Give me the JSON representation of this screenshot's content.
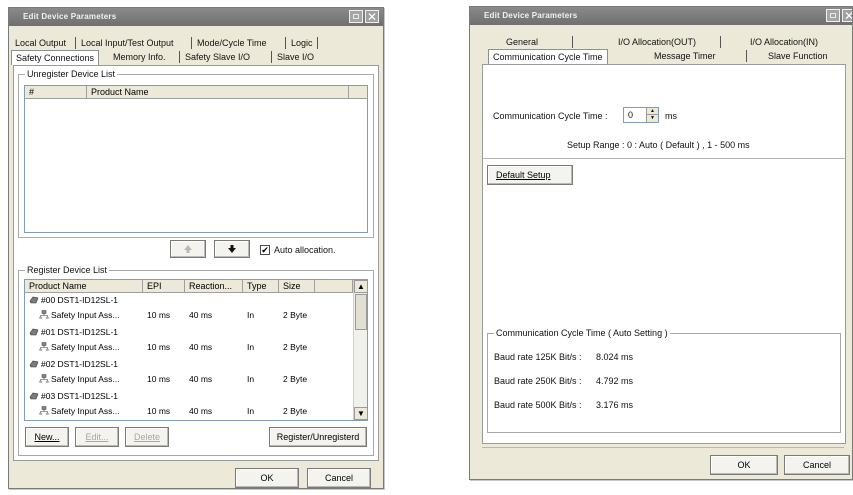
{
  "left_window": {
    "title": "Edit Device Parameters",
    "tabs_row1": [
      "Local Output",
      "Local Input/Test Output",
      "Mode/Cycle Time",
      "Logic"
    ],
    "tabs_row2": [
      "Safety Connections",
      "Memory Info.",
      "Safety Slave I/O",
      "Slave I/O"
    ],
    "unregister": {
      "title": "Unregister Device List",
      "col_num": "#",
      "col_product": "Product Name"
    },
    "auto_allocation": {
      "label": "Auto allocation.",
      "checked": true,
      "mark": "✔"
    },
    "register": {
      "title": "Register Device List",
      "columns": [
        "Product Name",
        "EPI",
        "Reaction...",
        "Type",
        "Size"
      ],
      "devices": [
        {
          "name": "#00 DST1-ID12SL-1",
          "sub": "Safety Input Ass...",
          "epi": "10 ms",
          "reaction": "40 ms",
          "type": "In",
          "size": "2 Byte"
        },
        {
          "name": "#01 DST1-ID12SL-1",
          "sub": "Safety Input Ass...",
          "epi": "10 ms",
          "reaction": "40 ms",
          "type": "In",
          "size": "2 Byte"
        },
        {
          "name": "#02 DST1-ID12SL-1",
          "sub": "Safety Input Ass...",
          "epi": "10 ms",
          "reaction": "40 ms",
          "type": "In",
          "size": "2 Byte"
        },
        {
          "name": "#03 DST1-ID12SL-1",
          "sub": "Safety Input Ass...",
          "epi": "10 ms",
          "reaction": "40 ms",
          "type": "In",
          "size": "2 Byte"
        }
      ]
    },
    "buttons": {
      "new": "New...",
      "edit": "Edit...",
      "delete": "Delete",
      "register_unregistered": "Register/Unregisterd"
    },
    "ok": "OK",
    "cancel": "Cancel"
  },
  "right_window": {
    "title": "Edit Device Parameters",
    "tabs_row1": [
      "General",
      "I/O Allocation(OUT)",
      "I/O Allocation(IN)"
    ],
    "tabs_row2": [
      "Communication Cycle Time",
      "Message Timer",
      "Slave Function"
    ],
    "comm_cycle_label": "Communication Cycle Time :",
    "comm_cycle_value": "0",
    "comm_cycle_unit": "ms",
    "setup_range": "Setup Range :  0 : Auto ( Default ) ,  1 - 500 ms",
    "default_setup": "Default Setup",
    "auto_setting": {
      "title": "Communication Cycle Time ( Auto Setting )",
      "rows": [
        {
          "label": "Baud rate 125K Bit/s :",
          "value": "8.024 ms"
        },
        {
          "label": "Baud rate 250K Bit/s :",
          "value": "4.792 ms"
        },
        {
          "label": "Baud rate 500K Bit/s :",
          "value": "3.176 ms"
        }
      ]
    },
    "ok": "OK",
    "cancel": "Cancel"
  }
}
